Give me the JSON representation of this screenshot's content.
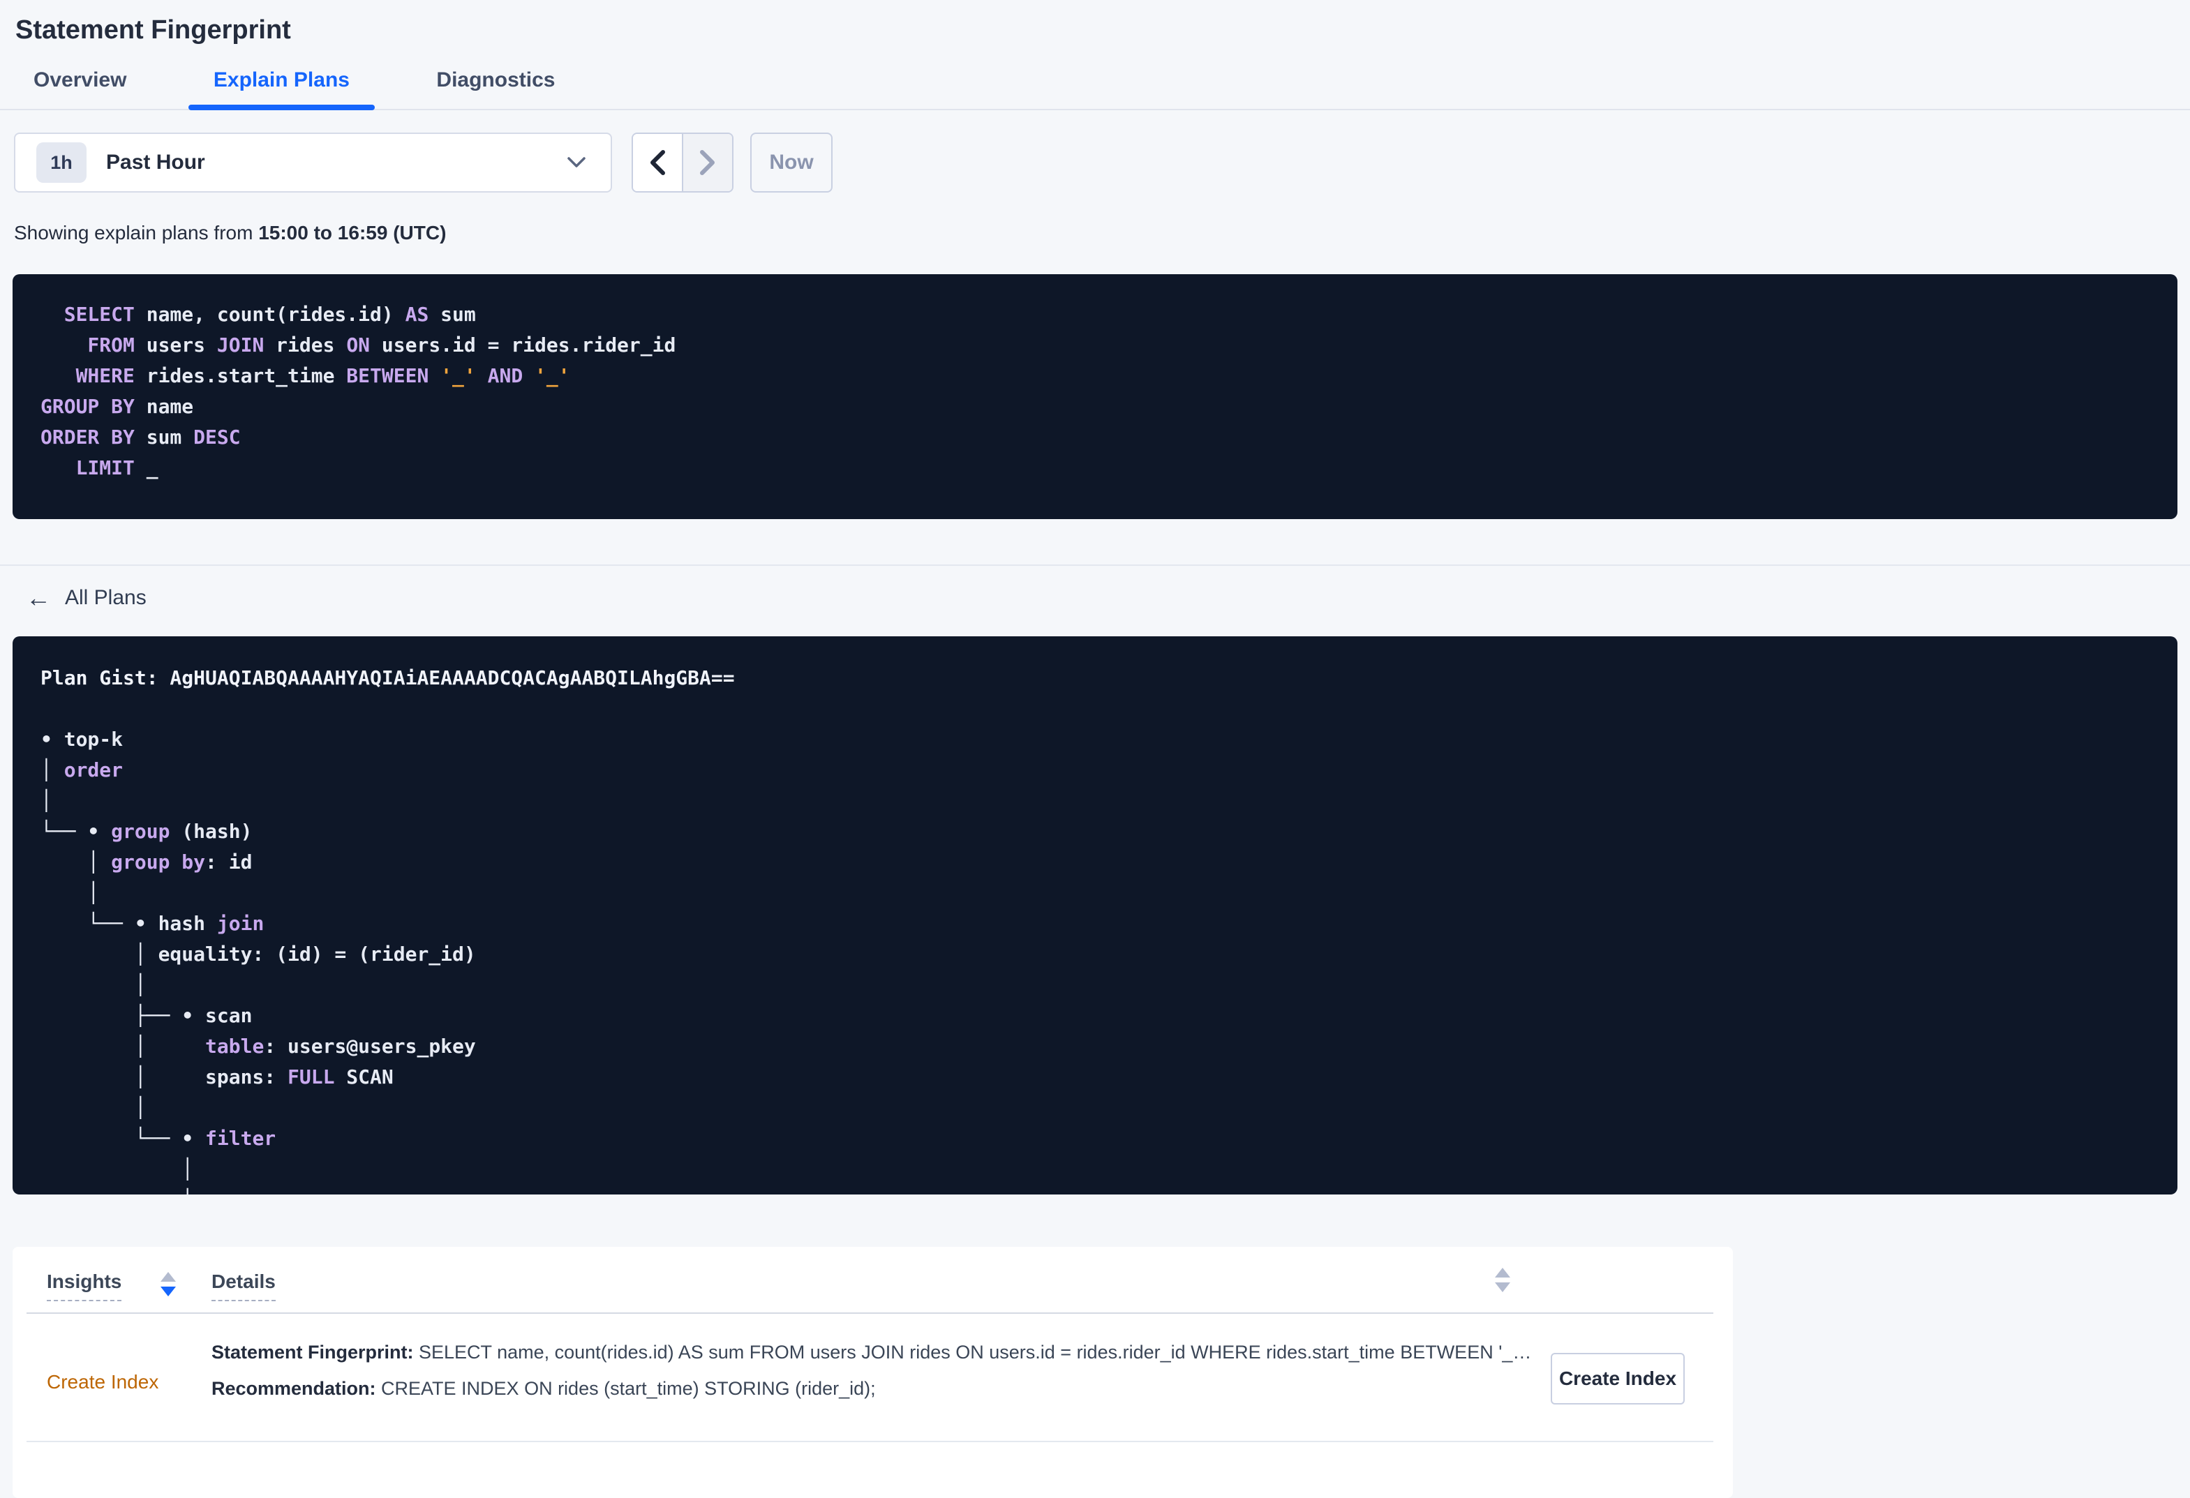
{
  "page_title": "Statement Fingerprint",
  "tabs": [
    {
      "label": "Overview",
      "active": false
    },
    {
      "label": "Explain Plans",
      "active": true
    },
    {
      "label": "Diagnostics",
      "active": false
    }
  ],
  "time_controls": {
    "interval_badge": "1h",
    "selected_range": "Past Hour",
    "now_label": "Now",
    "dropdown_icon": "chevron-down-icon",
    "prev_icon": "chevron-left-icon",
    "next_icon": "chevron-right-icon"
  },
  "showing": {
    "prefix": "Showing explain plans from ",
    "range_bold": "15:00 to 16:59 (UTC)"
  },
  "sql_block": {
    "lines": [
      [
        {
          "c": "k",
          "t": "  SELECT"
        },
        {
          "c": "p",
          "t": " name, count(rides.id) "
        },
        {
          "c": "k",
          "t": "AS"
        },
        {
          "c": "p",
          "t": " sum"
        }
      ],
      [
        {
          "c": "k",
          "t": "    FROM"
        },
        {
          "c": "p",
          "t": " users "
        },
        {
          "c": "k",
          "t": "JOIN"
        },
        {
          "c": "p",
          "t": " rides "
        },
        {
          "c": "k",
          "t": "ON"
        },
        {
          "c": "p",
          "t": " users.id = rides.rider_id"
        }
      ],
      [
        {
          "c": "k",
          "t": "   WHERE"
        },
        {
          "c": "p",
          "t": " rides.start_time "
        },
        {
          "c": "k",
          "t": "BETWEEN"
        },
        {
          "c": "p",
          "t": " "
        },
        {
          "c": "o",
          "t": "'_'"
        },
        {
          "c": "p",
          "t": " "
        },
        {
          "c": "k",
          "t": "AND"
        },
        {
          "c": "p",
          "t": " "
        },
        {
          "c": "o",
          "t": "'_'"
        }
      ],
      [
        {
          "c": "k",
          "t": "GROUP BY"
        },
        {
          "c": "p",
          "t": " name"
        }
      ],
      [
        {
          "c": "k",
          "t": "ORDER BY"
        },
        {
          "c": "p",
          "t": " sum "
        },
        {
          "c": "k",
          "t": "DESC"
        }
      ],
      [
        {
          "c": "k",
          "t": "   LIMIT"
        },
        {
          "c": "p",
          "t": " _"
        }
      ]
    ]
  },
  "all_plans": {
    "back_arrow_icon": "arrow-left-icon",
    "label": "All Plans"
  },
  "plan_block": {
    "lines": [
      [
        {
          "c": "g",
          "t": "Plan Gist: AgHUAQIABQAAAAHYAQIAiAEAAAADCQACAgAABQILAhgGBA=="
        }
      ],
      [],
      [
        {
          "c": "p",
          "t": "• top-k"
        }
      ],
      [
        {
          "c": "p",
          "t": "│ "
        },
        {
          "c": "k",
          "t": "order"
        }
      ],
      [
        {
          "c": "p",
          "t": "│"
        }
      ],
      [
        {
          "c": "p",
          "t": "└── • "
        },
        {
          "c": "k",
          "t": "group"
        },
        {
          "c": "p",
          "t": " (hash)"
        }
      ],
      [
        {
          "c": "p",
          "t": "    │ "
        },
        {
          "c": "k",
          "t": "group by"
        },
        {
          "c": "p",
          "t": ": id"
        }
      ],
      [
        {
          "c": "p",
          "t": "    │"
        }
      ],
      [
        {
          "c": "p",
          "t": "    └── • hash "
        },
        {
          "c": "k",
          "t": "join"
        }
      ],
      [
        {
          "c": "p",
          "t": "        │ equality: (id) = (rider_id)"
        }
      ],
      [
        {
          "c": "p",
          "t": "        │"
        }
      ],
      [
        {
          "c": "p",
          "t": "        ├── • scan"
        }
      ],
      [
        {
          "c": "p",
          "t": "        │     "
        },
        {
          "c": "k",
          "t": "table"
        },
        {
          "c": "p",
          "t": ": users@users_pkey"
        }
      ],
      [
        {
          "c": "p",
          "t": "        │     spans: "
        },
        {
          "c": "k",
          "t": "FULL"
        },
        {
          "c": "p",
          "t": " SCAN"
        }
      ],
      [
        {
          "c": "p",
          "t": "        │"
        }
      ],
      [
        {
          "c": "p",
          "t": "        └── • "
        },
        {
          "c": "k",
          "t": "filter"
        }
      ],
      [
        {
          "c": "p",
          "t": "            │"
        }
      ],
      [
        {
          "c": "p",
          "t": "            │"
        }
      ]
    ]
  },
  "insights_table": {
    "columns": [
      {
        "label": "Insights",
        "sort": "desc"
      },
      {
        "label": "Details",
        "sort": "none"
      }
    ],
    "row": {
      "insight": "Create Index",
      "detail_1_label": "Statement Fingerprint:",
      "detail_1_text": " SELECT name, count(rides.id) AS sum FROM users JOIN rides ON users.id = rides.rider_id WHERE rides.start_time BETWEEN '_…",
      "detail_2_label": "Recommendation:",
      "detail_2_text": " CREATE INDEX ON rides (start_time) STORING (rider_id);",
      "action_label": "Create Index"
    }
  },
  "colors": {
    "page_bg": "#F5F7FA",
    "accent_blue": "#1565FC",
    "insight_orange": "#BD6604",
    "code_bg": "#0E1728",
    "code_text": "#E7EBF4",
    "code_keyword": "#C8A9EE",
    "code_literal": "#F0A43D",
    "disabled_gray": "#8A94AE"
  }
}
